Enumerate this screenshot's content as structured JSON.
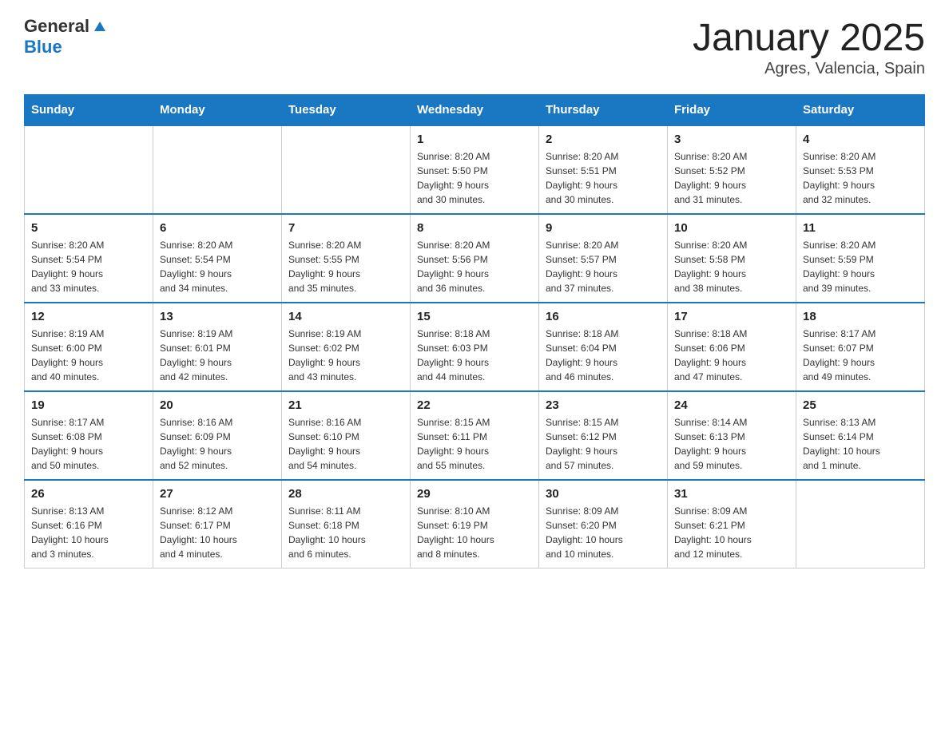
{
  "header": {
    "logo_general": "General",
    "logo_blue": "Blue",
    "title": "January 2025",
    "subtitle": "Agres, Valencia, Spain"
  },
  "days_of_week": [
    "Sunday",
    "Monday",
    "Tuesday",
    "Wednesday",
    "Thursday",
    "Friday",
    "Saturday"
  ],
  "weeks": [
    {
      "days": [
        {
          "number": "",
          "info": ""
        },
        {
          "number": "",
          "info": ""
        },
        {
          "number": "",
          "info": ""
        },
        {
          "number": "1",
          "info": "Sunrise: 8:20 AM\nSunset: 5:50 PM\nDaylight: 9 hours\nand 30 minutes."
        },
        {
          "number": "2",
          "info": "Sunrise: 8:20 AM\nSunset: 5:51 PM\nDaylight: 9 hours\nand 30 minutes."
        },
        {
          "number": "3",
          "info": "Sunrise: 8:20 AM\nSunset: 5:52 PM\nDaylight: 9 hours\nand 31 minutes."
        },
        {
          "number": "4",
          "info": "Sunrise: 8:20 AM\nSunset: 5:53 PM\nDaylight: 9 hours\nand 32 minutes."
        }
      ]
    },
    {
      "days": [
        {
          "number": "5",
          "info": "Sunrise: 8:20 AM\nSunset: 5:54 PM\nDaylight: 9 hours\nand 33 minutes."
        },
        {
          "number": "6",
          "info": "Sunrise: 8:20 AM\nSunset: 5:54 PM\nDaylight: 9 hours\nand 34 minutes."
        },
        {
          "number": "7",
          "info": "Sunrise: 8:20 AM\nSunset: 5:55 PM\nDaylight: 9 hours\nand 35 minutes."
        },
        {
          "number": "8",
          "info": "Sunrise: 8:20 AM\nSunset: 5:56 PM\nDaylight: 9 hours\nand 36 minutes."
        },
        {
          "number": "9",
          "info": "Sunrise: 8:20 AM\nSunset: 5:57 PM\nDaylight: 9 hours\nand 37 minutes."
        },
        {
          "number": "10",
          "info": "Sunrise: 8:20 AM\nSunset: 5:58 PM\nDaylight: 9 hours\nand 38 minutes."
        },
        {
          "number": "11",
          "info": "Sunrise: 8:20 AM\nSunset: 5:59 PM\nDaylight: 9 hours\nand 39 minutes."
        }
      ]
    },
    {
      "days": [
        {
          "number": "12",
          "info": "Sunrise: 8:19 AM\nSunset: 6:00 PM\nDaylight: 9 hours\nand 40 minutes."
        },
        {
          "number": "13",
          "info": "Sunrise: 8:19 AM\nSunset: 6:01 PM\nDaylight: 9 hours\nand 42 minutes."
        },
        {
          "number": "14",
          "info": "Sunrise: 8:19 AM\nSunset: 6:02 PM\nDaylight: 9 hours\nand 43 minutes."
        },
        {
          "number": "15",
          "info": "Sunrise: 8:18 AM\nSunset: 6:03 PM\nDaylight: 9 hours\nand 44 minutes."
        },
        {
          "number": "16",
          "info": "Sunrise: 8:18 AM\nSunset: 6:04 PM\nDaylight: 9 hours\nand 46 minutes."
        },
        {
          "number": "17",
          "info": "Sunrise: 8:18 AM\nSunset: 6:06 PM\nDaylight: 9 hours\nand 47 minutes."
        },
        {
          "number": "18",
          "info": "Sunrise: 8:17 AM\nSunset: 6:07 PM\nDaylight: 9 hours\nand 49 minutes."
        }
      ]
    },
    {
      "days": [
        {
          "number": "19",
          "info": "Sunrise: 8:17 AM\nSunset: 6:08 PM\nDaylight: 9 hours\nand 50 minutes."
        },
        {
          "number": "20",
          "info": "Sunrise: 8:16 AM\nSunset: 6:09 PM\nDaylight: 9 hours\nand 52 minutes."
        },
        {
          "number": "21",
          "info": "Sunrise: 8:16 AM\nSunset: 6:10 PM\nDaylight: 9 hours\nand 54 minutes."
        },
        {
          "number": "22",
          "info": "Sunrise: 8:15 AM\nSunset: 6:11 PM\nDaylight: 9 hours\nand 55 minutes."
        },
        {
          "number": "23",
          "info": "Sunrise: 8:15 AM\nSunset: 6:12 PM\nDaylight: 9 hours\nand 57 minutes."
        },
        {
          "number": "24",
          "info": "Sunrise: 8:14 AM\nSunset: 6:13 PM\nDaylight: 9 hours\nand 59 minutes."
        },
        {
          "number": "25",
          "info": "Sunrise: 8:13 AM\nSunset: 6:14 PM\nDaylight: 10 hours\nand 1 minute."
        }
      ]
    },
    {
      "days": [
        {
          "number": "26",
          "info": "Sunrise: 8:13 AM\nSunset: 6:16 PM\nDaylight: 10 hours\nand 3 minutes."
        },
        {
          "number": "27",
          "info": "Sunrise: 8:12 AM\nSunset: 6:17 PM\nDaylight: 10 hours\nand 4 minutes."
        },
        {
          "number": "28",
          "info": "Sunrise: 8:11 AM\nSunset: 6:18 PM\nDaylight: 10 hours\nand 6 minutes."
        },
        {
          "number": "29",
          "info": "Sunrise: 8:10 AM\nSunset: 6:19 PM\nDaylight: 10 hours\nand 8 minutes."
        },
        {
          "number": "30",
          "info": "Sunrise: 8:09 AM\nSunset: 6:20 PM\nDaylight: 10 hours\nand 10 minutes."
        },
        {
          "number": "31",
          "info": "Sunrise: 8:09 AM\nSunset: 6:21 PM\nDaylight: 10 hours\nand 12 minutes."
        },
        {
          "number": "",
          "info": ""
        }
      ]
    }
  ]
}
